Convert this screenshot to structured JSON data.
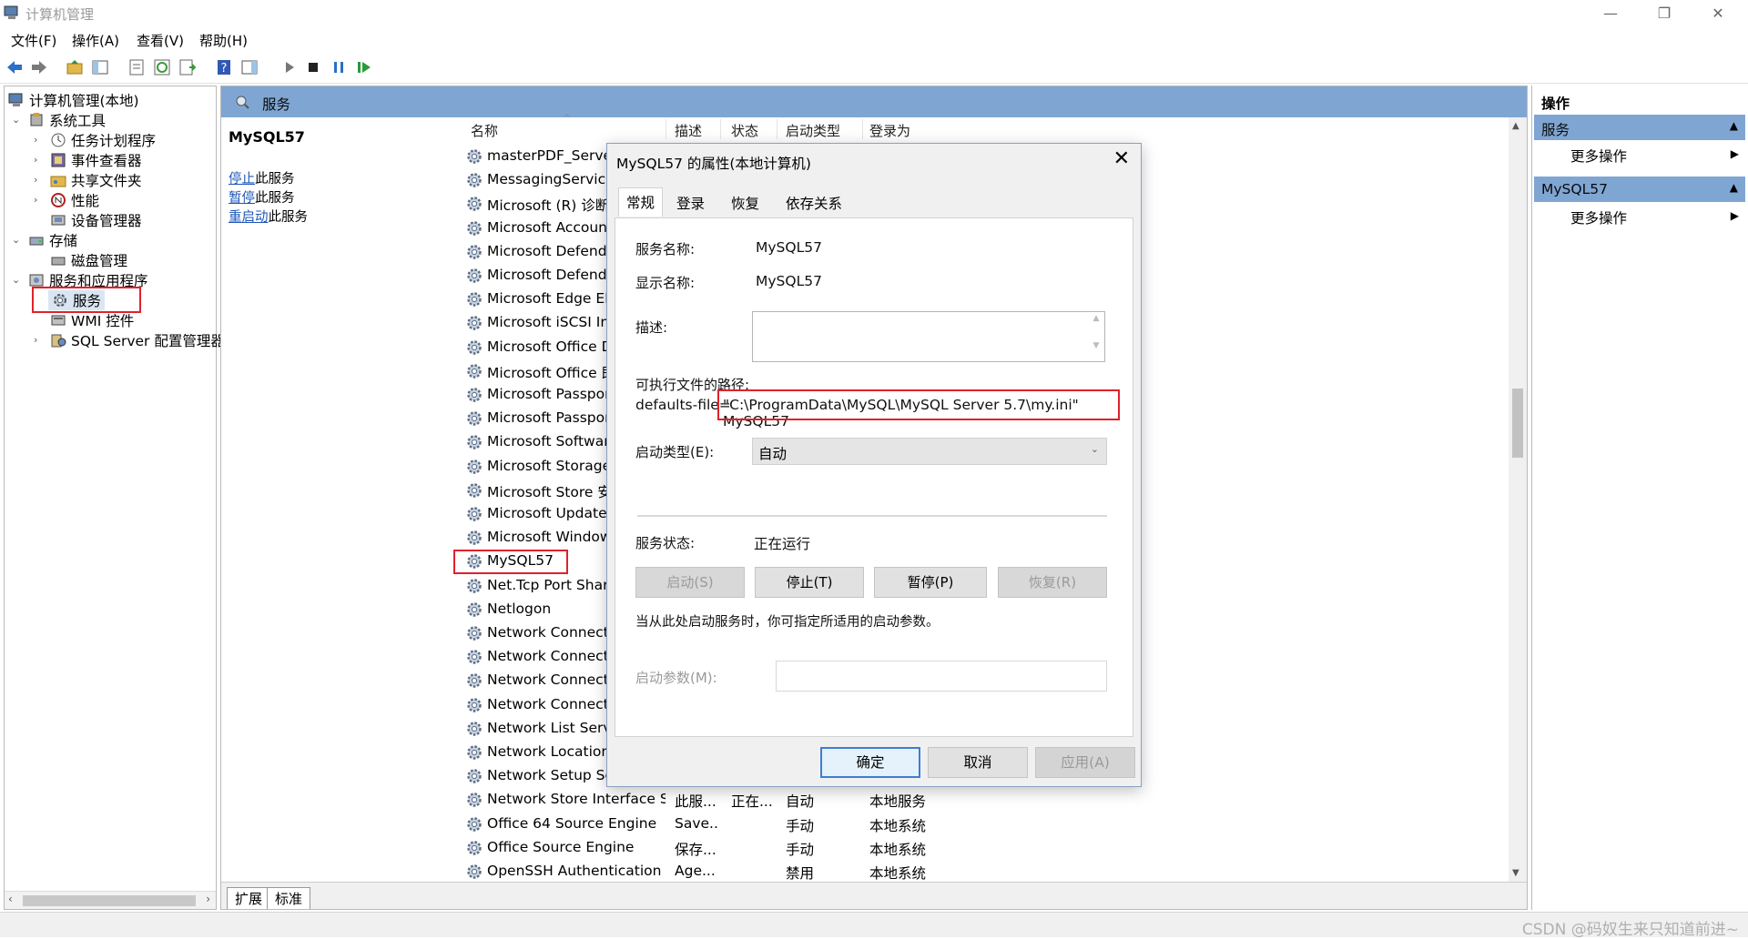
{
  "window": {
    "title": "计算机管理",
    "controls": [
      "—",
      "❐",
      "✕"
    ]
  },
  "menubar": [
    "文件(F)",
    "操作(A)",
    "查看(V)",
    "帮助(H)"
  ],
  "tree": {
    "root": "计算机管理(本地)",
    "system_tools": "系统工具",
    "task_scheduler": "任务计划程序",
    "event_viewer": "事件查看器",
    "shared_folders": "共享文件夹",
    "performance": "性能",
    "device_manager": "设备管理器",
    "storage": "存储",
    "disk_management": "磁盘管理",
    "services_apps": "服务和应用程序",
    "services": "服务",
    "wmi": "WMI 控件",
    "sql_config": "SQL Server 配置管理器"
  },
  "center": {
    "header": "服务",
    "selected_name": "MySQL57",
    "link_stop": "停止",
    "link_stop_suffix": "此服务",
    "link_pause": "暂停",
    "link_pause_suffix": "此服务",
    "link_restart": "重启动",
    "link_restart_suffix": "此服务",
    "columns": [
      "名称",
      "描述",
      "状态",
      "启动类型",
      "登录为"
    ],
    "rows": [
      {
        "name": "masterPDF_Server",
        "desc": "",
        "status": "",
        "startup": "",
        "logon": ""
      },
      {
        "name": "MessagingService_",
        "desc": "",
        "status": "",
        "startup": "",
        "logon": ""
      },
      {
        "name": "Microsoft (R) 诊断中",
        "desc": "",
        "status": "",
        "startup": "",
        "logon": ""
      },
      {
        "name": "Microsoft Account",
        "desc": "",
        "status": "",
        "startup": "",
        "logon": ""
      },
      {
        "name": "Microsoft Defende",
        "desc": "",
        "status": "",
        "startup": "",
        "logon": ""
      },
      {
        "name": "Microsoft Defende",
        "desc": "",
        "status": "",
        "startup": "",
        "logon": ""
      },
      {
        "name": "Microsoft Edge Elev",
        "desc": "",
        "status": "",
        "startup": "",
        "logon": ""
      },
      {
        "name": "Microsoft iSCSI Init",
        "desc": "",
        "status": "",
        "startup": "",
        "logon": ""
      },
      {
        "name": "Microsoft Office Di",
        "desc": "",
        "status": "",
        "startup": "",
        "logon": ""
      },
      {
        "name": "Microsoft Office 即",
        "desc": "",
        "status": "",
        "startup": "",
        "logon": ""
      },
      {
        "name": "Microsoft Passport",
        "desc": "",
        "status": "",
        "startup": "",
        "logon": ""
      },
      {
        "name": "Microsoft Passport",
        "desc": "",
        "status": "",
        "startup": "",
        "logon": ""
      },
      {
        "name": "Microsoft Software",
        "desc": "",
        "status": "",
        "startup": "",
        "logon": ""
      },
      {
        "name": "Microsoft Storage S",
        "desc": "",
        "status": "",
        "startup": "",
        "logon": ""
      },
      {
        "name": "Microsoft Store 安",
        "desc": "",
        "status": "",
        "startup": "",
        "logon": ""
      },
      {
        "name": "Microsoft Update H",
        "desc": "",
        "status": "",
        "startup": "",
        "logon": ""
      },
      {
        "name": "Microsoft Windows",
        "desc": "",
        "status": "",
        "startup": "",
        "logon": ""
      },
      {
        "name": "MySQL57",
        "desc": "",
        "status": "",
        "startup": "",
        "logon": ""
      },
      {
        "name": "Net.Tcp Port Sharin",
        "desc": "",
        "status": "",
        "startup": "",
        "logon": ""
      },
      {
        "name": "Netlogon",
        "desc": "",
        "status": "",
        "startup": "",
        "logon": ""
      },
      {
        "name": "Network Connecte",
        "desc": "",
        "status": "",
        "startup": "",
        "logon": ""
      },
      {
        "name": "Network Connectio",
        "desc": "",
        "status": "",
        "startup": "",
        "logon": ""
      },
      {
        "name": "Network Connectio",
        "desc": "",
        "status": "",
        "startup": "",
        "logon": ""
      },
      {
        "name": "Network Connectiv",
        "desc": "",
        "status": "",
        "startup": "",
        "logon": ""
      },
      {
        "name": "Network List Servic",
        "desc": "",
        "status": "",
        "startup": "",
        "logon": ""
      },
      {
        "name": "Network Location A",
        "desc": "",
        "status": "",
        "startup": "",
        "logon": ""
      },
      {
        "name": "Network Setup Ser",
        "desc": "",
        "status": "",
        "startup": "",
        "logon": ""
      },
      {
        "name": "Network Store Interface Se...",
        "desc": "此服...",
        "status": "正在...",
        "startup": "自动",
        "logon": "本地服务"
      },
      {
        "name": "Office 64 Source Engine",
        "desc": "Save...",
        "status": "",
        "startup": "手动",
        "logon": "本地系统"
      },
      {
        "name": "Office Source Engine",
        "desc": "保存...",
        "status": "",
        "startup": "手动",
        "logon": "本地系统"
      },
      {
        "name": "OpenSSH Authentication ...",
        "desc": "Age...",
        "status": "",
        "startup": "禁用",
        "logon": "本地系统"
      }
    ],
    "bottom_tabs": [
      "扩展",
      "标准"
    ]
  },
  "actions": {
    "title": "操作",
    "section1": "服务",
    "section1_item": "更多操作",
    "section2": "MySQL57",
    "section2_item": "更多操作"
  },
  "dialog": {
    "title": "MySQL57 的属性(本地计算机)",
    "tabs": [
      "常规",
      "登录",
      "恢复",
      "依存关系"
    ],
    "service_name_label": "服务名称:",
    "service_name": "MySQL57",
    "display_name_label": "显示名称:",
    "display_name": "MySQL57",
    "description_label": "描述:",
    "exe_path_label": "可执行文件的路径:",
    "exe_path_prefix": "defaults-file=",
    "exe_path_value": "\"C:\\ProgramData\\MySQL\\MySQL Server 5.7\\my.ini\" MySQL57",
    "startup_type_label": "启动类型(E):",
    "startup_type": "自动",
    "status_label": "服务状态:",
    "status": "正在运行",
    "btn_start": "启动(S)",
    "btn_stop": "停止(T)",
    "btn_pause": "暂停(P)",
    "btn_resume": "恢复(R)",
    "hint": "当从此处启动服务时，你可指定所适用的启动参数。",
    "params_label": "启动参数(M):",
    "params_value": "",
    "ok": "确定",
    "cancel": "取消",
    "apply": "应用(A)"
  },
  "watermark": "CSDN @码奴生来只知道前进~",
  "colors": {
    "header_blue": "#7fa6d3",
    "highlight_red": "#e0212b",
    "link_blue": "#1e56b8"
  }
}
